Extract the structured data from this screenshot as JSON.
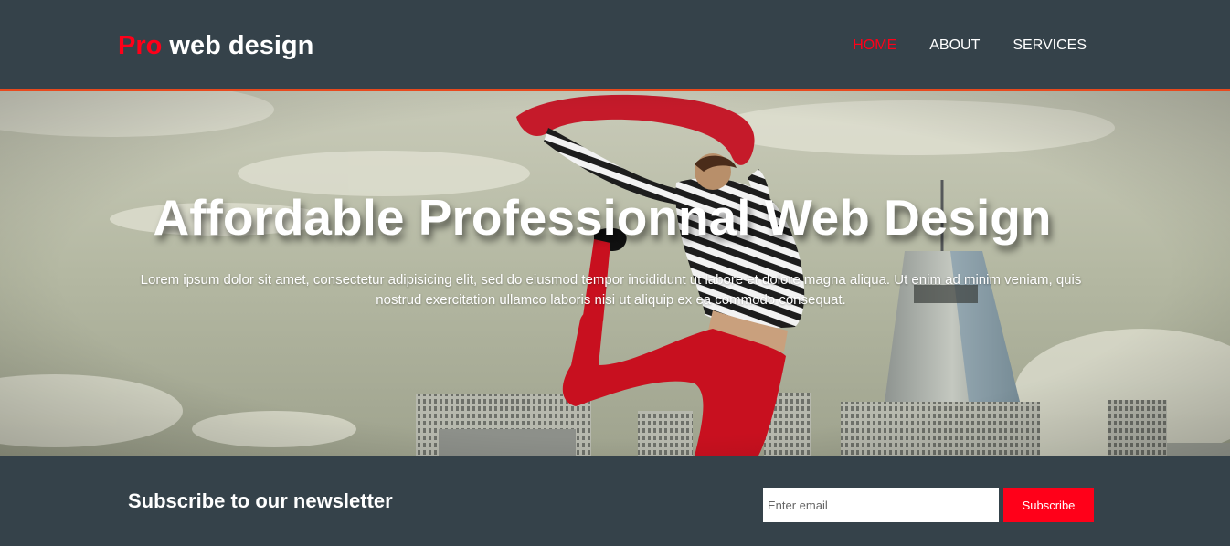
{
  "header": {
    "logo_highlight": "Pro",
    "logo_rest": "web design",
    "nav": [
      {
        "label": "Home",
        "active": true
      },
      {
        "label": "About",
        "active": false
      },
      {
        "label": "Services",
        "active": false
      }
    ]
  },
  "showcase": {
    "title": "Affordable Professionnal Web Design",
    "text": "Lorem ipsum dolor sit amet, consectetur adipisicing elit, sed do eiusmod tempor incididunt ut labore et dolore magna aliqua. Ut enim ad minim veniam, quis nostrud exercitation ullamco laboris nisi ut aliquip ex ea commodo consequat."
  },
  "newsletter": {
    "heading": "Subscribe to our newsletter",
    "email_placeholder": "Enter email",
    "email_value": "",
    "button_label": "Subscribe"
  },
  "colors": {
    "header_bg": "#35424a",
    "accent": "#ff0019",
    "border_accent": "#e8491d",
    "text": "#ffffff"
  }
}
